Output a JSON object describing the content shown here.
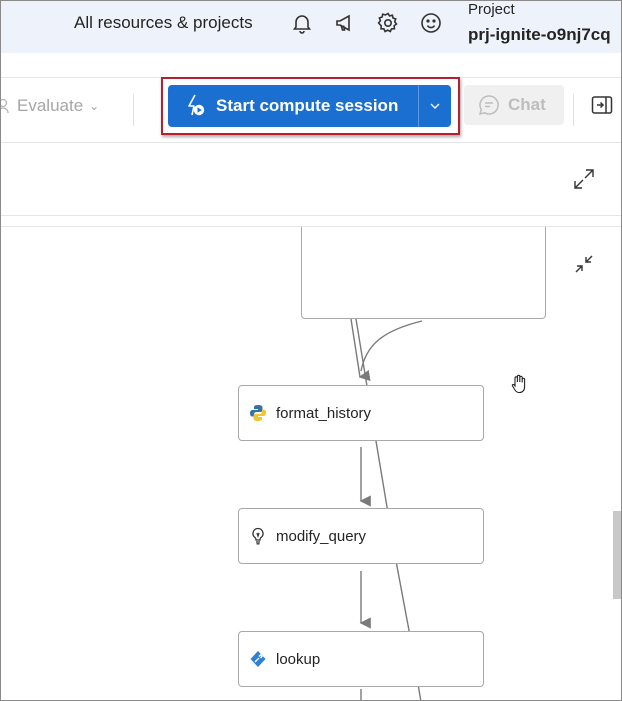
{
  "header": {
    "resources_link": "All resources & projects",
    "project_label": "Project",
    "project_name": "prj-ignite-o9nj7cq",
    "icons": [
      "bell-icon",
      "megaphone-icon",
      "gear-icon",
      "smiley-icon"
    ]
  },
  "toolbar": {
    "evaluate_label": "Evaluate",
    "start_compute_label": "Start compute session",
    "chat_label": "Chat"
  },
  "flow": {
    "nodes": [
      {
        "label": "format_history",
        "icon": "python-icon"
      },
      {
        "label": "modify_query",
        "icon": "lightbulb-icon"
      },
      {
        "label": "lookup",
        "icon": "tool-icon"
      }
    ]
  },
  "colors": {
    "primary": "#1b6fd1",
    "highlight_border": "#b5202e",
    "header_bg": "#eef2fa"
  }
}
